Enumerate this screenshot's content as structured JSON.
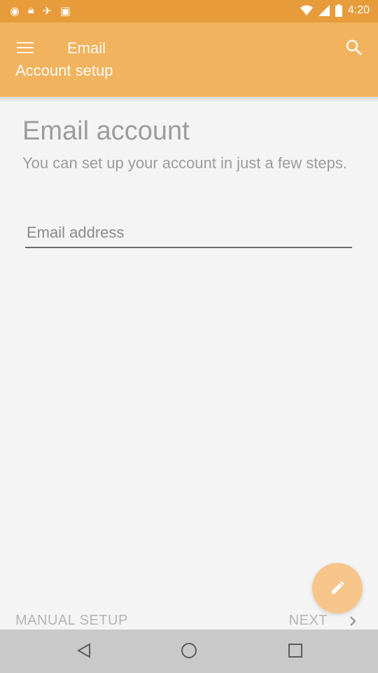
{
  "status_bar": {
    "time": "4:20",
    "left_icons": [
      "circle-icon",
      "lock-icon",
      "satellite-icon",
      "android-icon"
    ],
    "right_icons": [
      "wifi-icon",
      "signal-icon",
      "battery-icon"
    ]
  },
  "app_bar": {
    "title": "Email",
    "subtitle": "Account setup",
    "menu_icon": "menu-icon",
    "search_icon": "search-icon"
  },
  "main": {
    "heading": "Email account",
    "description": "You can set up your account in just a few steps.",
    "email_input": {
      "placeholder": "Email address",
      "value": ""
    }
  },
  "actions": {
    "manual_setup_label": "MANUAL SETUP",
    "next_label": "NEXT",
    "fab_icon": "pencil-icon"
  },
  "nav_bar": {
    "back_icon": "back-triangle-icon",
    "home_icon": "home-circle-icon",
    "recents_icon": "recents-square-icon"
  },
  "colors": {
    "status_bar": "#e89b3a",
    "app_bar": "#f1b35e",
    "fab": "#f7c58a",
    "background": "#f4f4f4",
    "nav_bar": "#c9c9c9"
  }
}
